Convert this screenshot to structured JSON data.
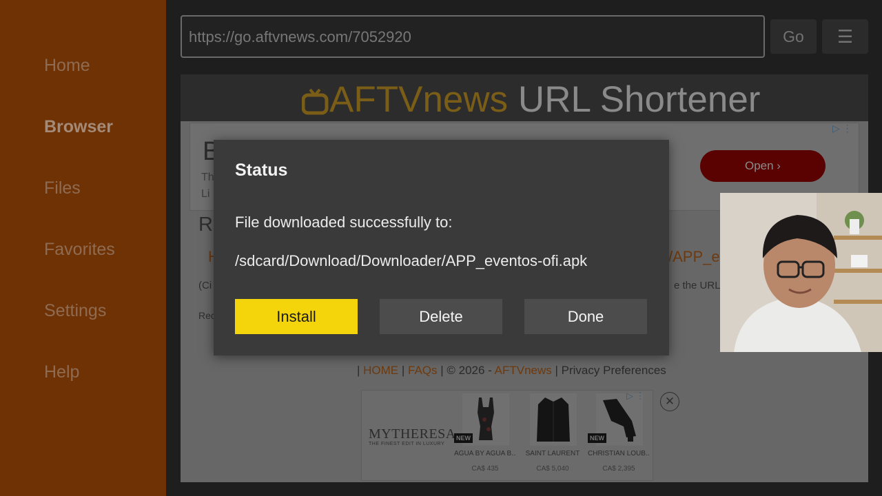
{
  "sidebar": {
    "items": [
      {
        "label": "Home"
      },
      {
        "label": "Browser",
        "active": true
      },
      {
        "label": "Files"
      },
      {
        "label": "Favorites"
      },
      {
        "label": "Settings"
      },
      {
        "label": "Help"
      }
    ]
  },
  "toolbar": {
    "url": "https://go.aftvnews.com/7052920",
    "go_label": "Go",
    "menu_icon": "hamburger-menu-icon"
  },
  "page": {
    "brand_prefix": "AFTVnews",
    "brand_suffix": " URL Shortener",
    "ad": {
      "headline_fragment": "B",
      "line1_fragment": "Th",
      "line2_fragment": "Li",
      "open_label": "Open ›"
    },
    "fragments": {
      "r": "R",
      "h": "H",
      "app_tail": "/APP_e",
      "ci": "(Ci",
      "url_end": "e the URL.)",
      "rec": "Rec"
    },
    "footer": {
      "sep1": "| ",
      "home": "HOME",
      "sep2": " | ",
      "faqs": "FAQs",
      "sep3": " | © 2026 - ",
      "aftvnews": "AFTVnews",
      "sep4": " |   ",
      "privacy": "Privacy Preferences"
    },
    "bottom_ad": {
      "logo": "MYTHERESA",
      "tagline": "THE FINEST EDIT IN LUXURY",
      "new_badge": "NEW",
      "products": [
        {
          "name": "AGUA BY AGUA B...",
          "price": "CA$ 435"
        },
        {
          "name": "SAINT LAURENT",
          "price": "CA$ 5,040"
        },
        {
          "name": "CHRISTIAN LOUB...",
          "price": "CA$ 2,395"
        }
      ],
      "close_symbol": "✕"
    }
  },
  "dialog": {
    "title": "Status",
    "message": "File downloaded successfully to:",
    "path": "/sdcard/Download/Downloader/APP_eventos-ofi.apk",
    "install_label": "Install",
    "delete_label": "Delete",
    "done_label": "Done"
  },
  "colors": {
    "sidebar": "#6e3205",
    "install_button": "#f4d50c",
    "dialog_bg": "#3a3a3a"
  }
}
